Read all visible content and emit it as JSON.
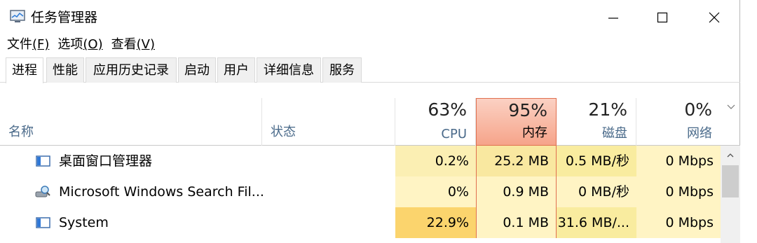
{
  "window": {
    "title": "任务管理器",
    "controls": {
      "minimize": "—",
      "maximize": "☐",
      "close": "✕"
    }
  },
  "menu": [
    {
      "label": "文件",
      "accel": "(F)"
    },
    {
      "label": "选项",
      "accel": "(O)"
    },
    {
      "label": "查看",
      "accel": "(V)"
    }
  ],
  "tabs": [
    {
      "label": "进程",
      "active": true
    },
    {
      "label": "性能",
      "active": false
    },
    {
      "label": "应用历史记录",
      "active": false
    },
    {
      "label": "启动",
      "active": false
    },
    {
      "label": "用户",
      "active": false
    },
    {
      "label": "详细信息",
      "active": false
    },
    {
      "label": "服务",
      "active": false
    }
  ],
  "columns": {
    "name": "名称",
    "status": "状态",
    "cpu": {
      "percent": "63%",
      "label": "CPU"
    },
    "memory": {
      "percent": "95%",
      "label": "内存"
    },
    "disk": {
      "percent": "21%",
      "label": "磁盘"
    },
    "network": {
      "percent": "0%",
      "label": "网络"
    }
  },
  "rows": [
    {
      "icon": "window-app-icon",
      "name": "桌面窗口管理器",
      "status": "",
      "cpu": "0.2%",
      "memory": "25.2 MB",
      "disk": "0.5 MB/秒",
      "network": "0 Mbps"
    },
    {
      "icon": "search-indexer-icon",
      "name": "Microsoft Windows Search Fil...",
      "status": "",
      "cpu": "0%",
      "memory": "0.9 MB",
      "disk": "0 MB/秒",
      "network": "0 Mbps"
    },
    {
      "icon": "window-app-icon",
      "name": "System",
      "status": "",
      "cpu": "22.9%",
      "memory": "0.1 MB",
      "disk": "31.6 MB/...",
      "network": "0 Mbps"
    }
  ],
  "colors": {
    "heat_light": "#fff4c4",
    "heat_medium": "#f9ec9f",
    "heat_high": "#fbd46d",
    "memory_header": "#f6a48a"
  }
}
